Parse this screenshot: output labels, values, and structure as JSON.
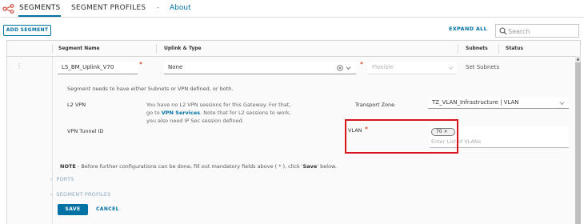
{
  "nav": {
    "tabs": [
      "SEGMENTS",
      "SEGMENT PROFILES"
    ],
    "separator": "-",
    "about": "About"
  },
  "toolbar": {
    "add_segment": "ADD SEGMENT",
    "expand_all": "EXPAND ALL",
    "search_placeholder": "Search"
  },
  "table": {
    "headers": [
      "Segment Name",
      "Uplink & Type",
      "Subnets",
      "Status"
    ]
  },
  "row": {
    "segment_name": "LS_BM_Uplink_V70",
    "uplink": "None",
    "type": "Flexible",
    "set_subnets": "Set Subnets",
    "message": "Segment needs to have either Subnets or VPN defined, or both.",
    "l2vpn_label": "L2 VPN",
    "l2vpn_info_1_pre": "You have no L2 VPN sessions for this Gateway. For that,",
    "l2vpn_info_2_pre": "go to ",
    "l2vpn_info_2_link": "VPN Services",
    "l2vpn_info_2_post": ". Note that for L2 sessions to work,",
    "l2vpn_info_3": "you also need IP Sec session defined.",
    "vpn_tunnel_label": "VPN Tunnel ID",
    "transport_zone_label": "Transport Zone",
    "transport_zone_value": "TZ_VLAN_Infrastructure | VLAN",
    "vlan_label": "VLAN",
    "vlan_chip": "70",
    "vlan_placeholder": "Enter List of VLANs",
    "note_label": "NOTE",
    "note_text_1": " - Before further configurations can be done, fill out mandatory fields above ( * ), click '",
    "note_save": "Save",
    "note_text_2": "' below.",
    "ports": "PORTS",
    "segment_profiles": "SEGMENT PROFILES",
    "save": "SAVE",
    "cancel": "CANCEL",
    "required": "*"
  },
  "icons": {
    "logo": "segments-network-icon",
    "search": "search-icon",
    "clear": "clear-circle-icon",
    "chevron": "chevron-down-icon",
    "expand": "chevron-right-icon",
    "menu": "vertical-ellipsis-icon"
  },
  "colors": {
    "accent": "#0072a3",
    "required": "#c92100",
    "highlight": "#d9141e"
  }
}
